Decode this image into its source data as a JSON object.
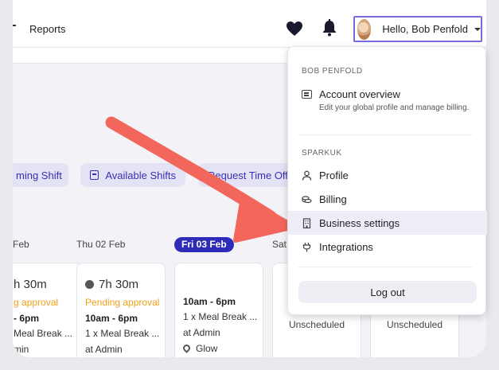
{
  "header": {
    "nav": {
      "reports": "Reports"
    },
    "user_greeting": "Hello, Bob Penfold"
  },
  "actions": {
    "upcoming_shift": "ming Shift",
    "available_shifts": "Available Shifts",
    "request_time_off": "Request Time Off"
  },
  "calendar": {
    "days": [
      "Feb",
      "Thu 02 Feb",
      "Fri 03 Feb",
      "Sat"
    ],
    "cards": [
      {
        "hours": "h 30m",
        "status": "g approval",
        "time": "- 6pm",
        "break": "Meal Break ...",
        "location": "min"
      },
      {
        "hours": "7h 30m",
        "status": "Pending approval",
        "time": "10am - 6pm",
        "break": "1 x Meal Break ...",
        "location": "at Admin"
      },
      {
        "time": "10am - 6pm",
        "break": "1 x Meal Break ...",
        "location": "at Admin",
        "site": "Glow"
      },
      {
        "unscheduled": "Unscheduled"
      },
      {
        "unscheduled": "Unscheduled"
      }
    ]
  },
  "dropdown": {
    "user_section": "BOB PENFOLD",
    "account_overview": {
      "title": "Account overview",
      "description": "Edit your global profile and manage billing."
    },
    "org_section": "SPARKUK",
    "items": [
      {
        "label": "Profile",
        "icon": "user-icon"
      },
      {
        "label": "Billing",
        "icon": "coins-icon"
      },
      {
        "label": "Business settings",
        "icon": "building-icon",
        "active": true
      },
      {
        "label": "Integrations",
        "icon": "plug-icon"
      }
    ],
    "logout": "Log out"
  },
  "colors": {
    "accent": "#2d2bb7",
    "pill_bg": "#e4e3f6",
    "pending": "#f0a11a",
    "arrow": "#f2665c"
  }
}
